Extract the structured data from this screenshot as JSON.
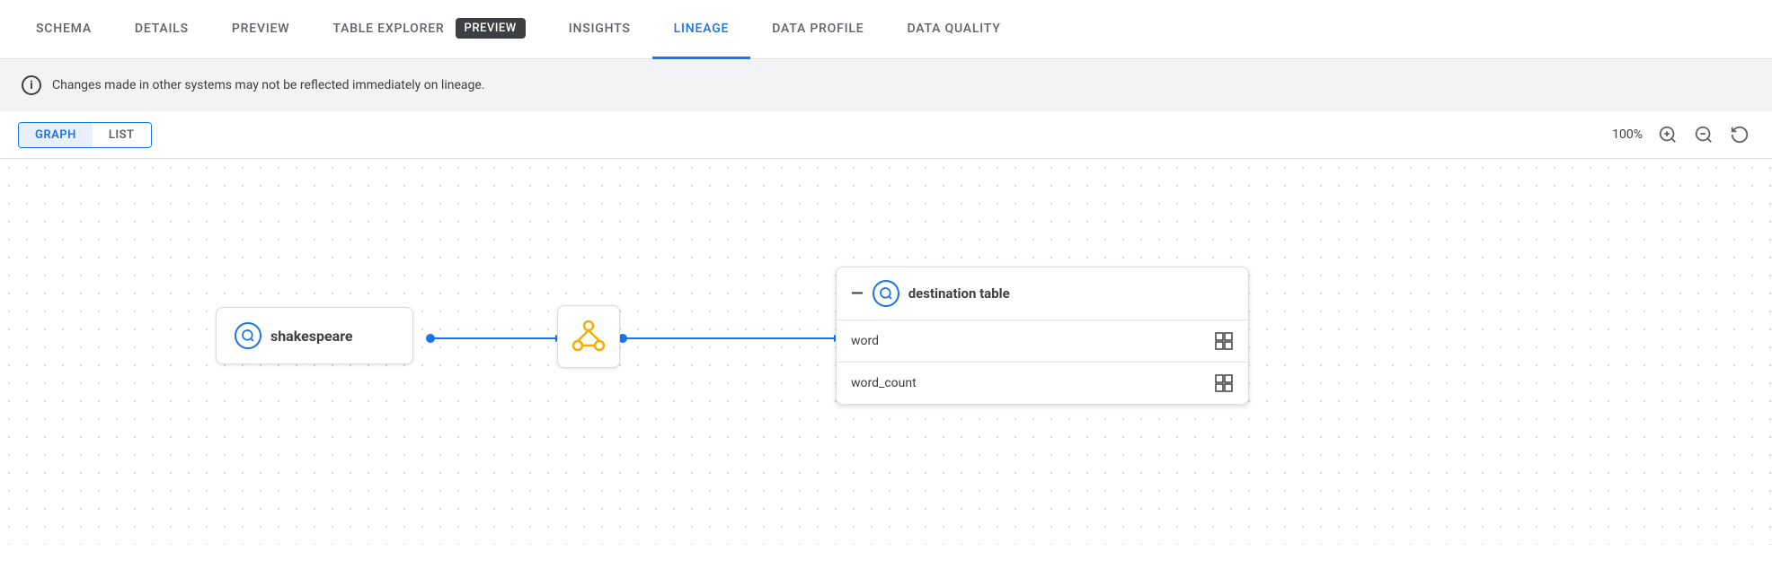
{
  "tabs": [
    {
      "id": "schema",
      "label": "SCHEMA",
      "active": false
    },
    {
      "id": "details",
      "label": "DETAILS",
      "active": false
    },
    {
      "id": "preview",
      "label": "PREVIEW",
      "active": false
    },
    {
      "id": "table-explorer",
      "label": "TABLE EXPLORER",
      "badge": "PREVIEW",
      "active": false
    },
    {
      "id": "insights",
      "label": "INSIGHTS",
      "active": false
    },
    {
      "id": "lineage",
      "label": "LINEAGE",
      "active": true
    },
    {
      "id": "data-profile",
      "label": "DATA PROFILE",
      "active": false
    },
    {
      "id": "data-quality",
      "label": "DATA QUALITY",
      "active": false
    }
  ],
  "info_banner": {
    "message": "Changes made in other systems may not be reflected immediately on lineage."
  },
  "toolbar": {
    "graph_label": "GRAPH",
    "list_label": "LIST",
    "zoom_level": "100%",
    "active_toggle": "graph"
  },
  "lineage_graph": {
    "source_node": {
      "label": "shakespeare",
      "icon": "⊕"
    },
    "transform_node": {
      "icon": "transform"
    },
    "destination_node": {
      "title": "destination table",
      "rows": [
        {
          "label": "word"
        },
        {
          "label": "word_count"
        }
      ]
    }
  },
  "zoom_icons": {
    "zoom_in": "⊕",
    "zoom_out": "⊖",
    "zoom_reset": "↺"
  },
  "colors": {
    "accent": "#1a73e8",
    "active_tab_underline": "#1a73e8",
    "badge_bg": "#3c4043",
    "orange": "#f9ab00"
  }
}
